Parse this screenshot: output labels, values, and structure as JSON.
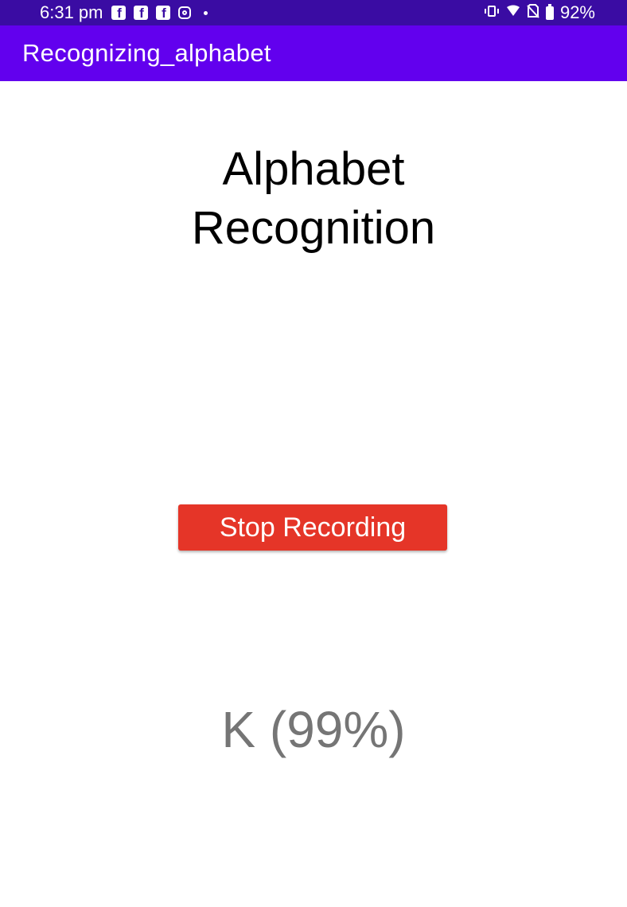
{
  "status_bar": {
    "time": "6:31 pm",
    "notification_icons": [
      "facebook-icon",
      "facebook-icon",
      "facebook-icon",
      "instagram-icon",
      "dot-icon"
    ],
    "system_icons": [
      "vibrate-icon",
      "wifi-icon",
      "no-sim-icon",
      "battery-icon"
    ],
    "battery": "92%",
    "bar_color": "#3a0ca3"
  },
  "app_bar": {
    "title": "Recognizing_alphabet",
    "color": "#6200ee"
  },
  "main": {
    "heading": "Alphabet Recognition",
    "button_label": "Stop Recording",
    "button_color": "#e53528",
    "result": "K (99%)"
  }
}
